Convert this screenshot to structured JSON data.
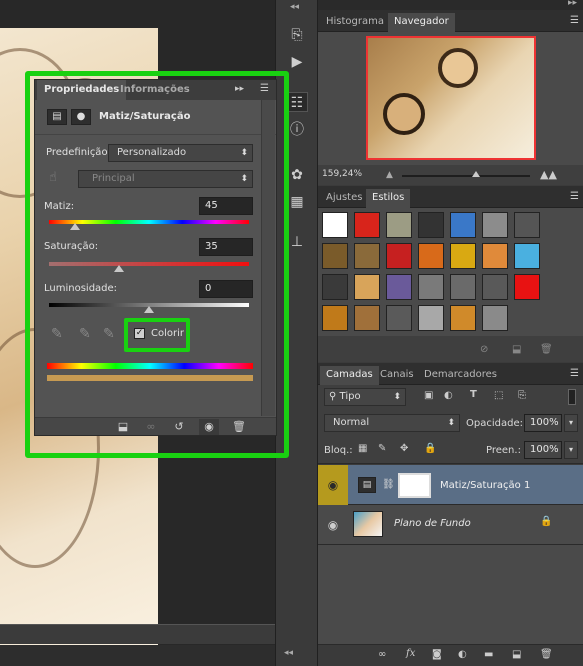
{
  "properties": {
    "tabs": [
      {
        "label": "Propriedades"
      },
      {
        "label": "Informações"
      }
    ],
    "title": "Matiz/Saturação",
    "preset_label": "Predefinição:",
    "preset_value": "Personalizado",
    "channel_value": "Principal",
    "hue_label": "Matiz:",
    "hue_value": "45",
    "hue_level": 0.13,
    "saturation_label": "Saturação:",
    "saturation_value": "35",
    "saturation_level": 0.35,
    "lightness_label": "Luminosidade:",
    "lightness_value": "0",
    "lightness_level": 0.5,
    "colorize_label": "Colorir",
    "colorize_checked": true
  },
  "top_dock": {
    "tabs": [
      {
        "label": "Histograma"
      },
      {
        "label": "Navegador"
      }
    ],
    "zoom_value": "159,24%"
  },
  "styles_panel": {
    "tabs": [
      {
        "label": "Ajustes"
      },
      {
        "label": "Estilos"
      }
    ]
  },
  "layers_panel": {
    "tabs": [
      {
        "label": "Camadas"
      },
      {
        "label": "Canais"
      },
      {
        "label": "Demarcadores"
      }
    ],
    "filter_value": "Tipo",
    "blend_mode": "Normal",
    "opacity_label": "Opacidade:",
    "opacity_value": "100%",
    "lock_label": "Bloq.:",
    "fill_label": "Preen.:",
    "fill_value": "100%",
    "layers": [
      {
        "name": "Matiz/Saturação 1"
      },
      {
        "name": "Plano de Fundo"
      }
    ]
  },
  "colors": {
    "highlight": "#19d111",
    "selected_layer": "#5a6e86",
    "visibility_active": "#b59a1e"
  },
  "icons": [
    "double-chevron-icon",
    "history-icon",
    "play-icon",
    "adjustments-icon",
    "info-icon",
    "paint-palette-icon",
    "grid-icon",
    "stamp-icon",
    "eye-icon",
    "trash-icon",
    "lock-icon",
    "link-icon",
    "fx-icon",
    "mask-icon",
    "folder-icon",
    "new-layer-icon",
    "menu-icon"
  ]
}
